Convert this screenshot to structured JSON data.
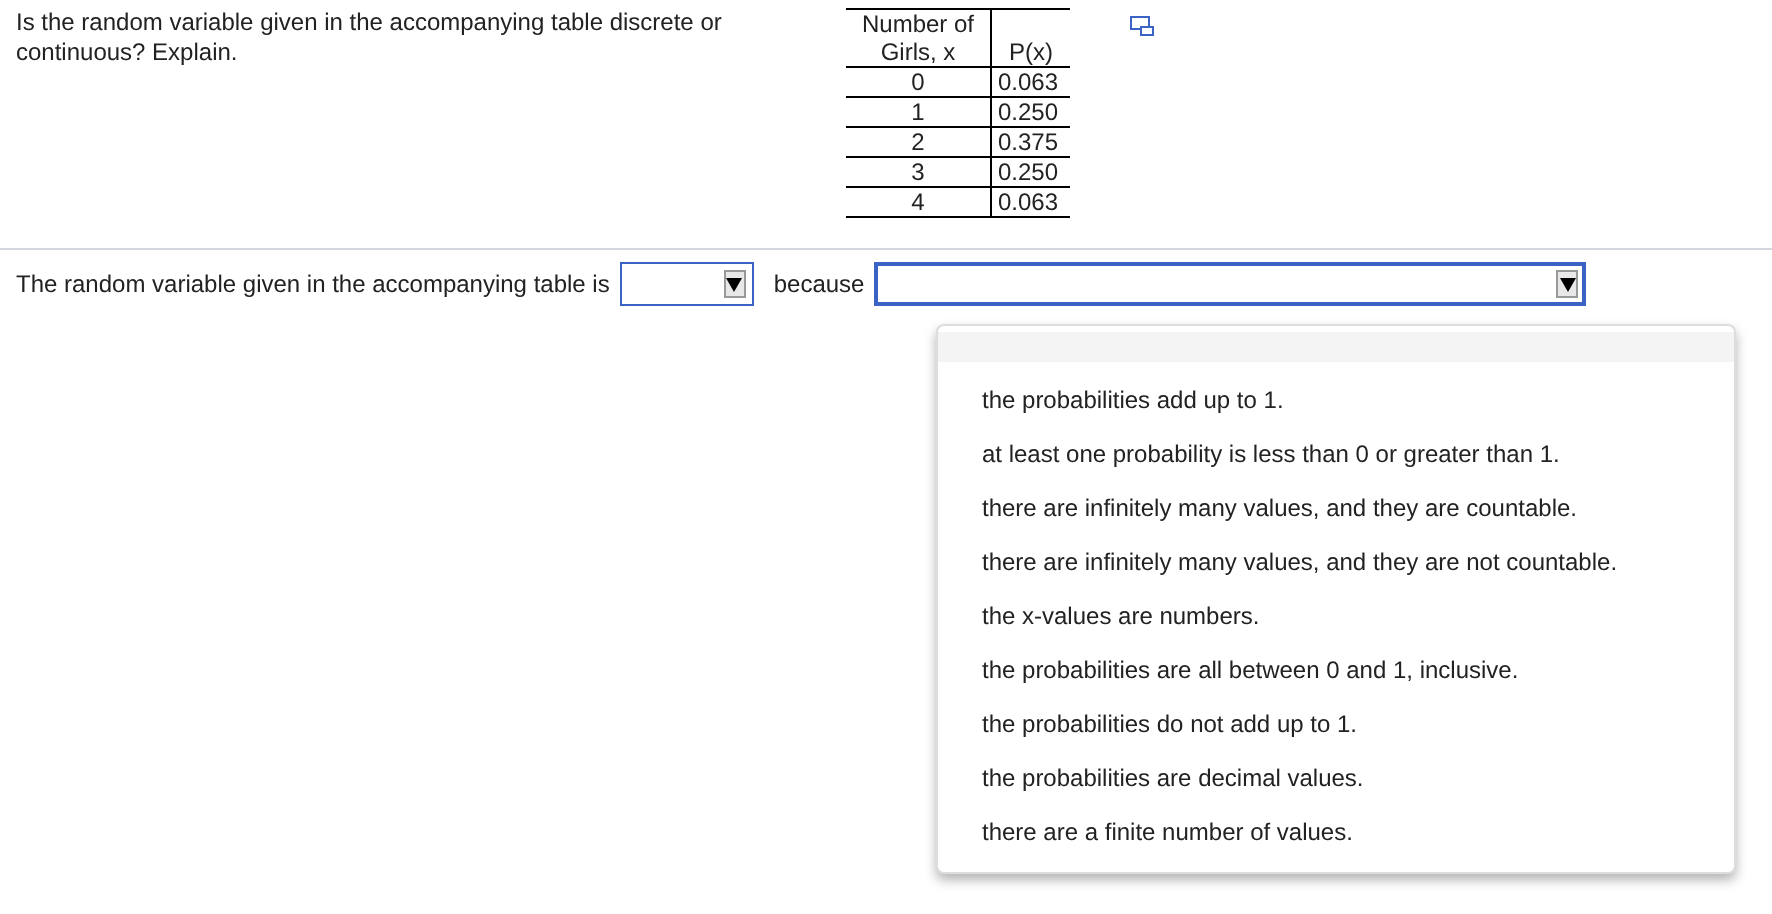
{
  "question": "Is the random variable given in the accompanying table discrete or continuous? Explain.",
  "table": {
    "columns": [
      "Number of Girls, x",
      "P(x)"
    ],
    "rows": [
      [
        "0",
        "0.063"
      ],
      [
        "1",
        "0.250"
      ],
      [
        "2",
        "0.375"
      ],
      [
        "3",
        "0.250"
      ],
      [
        "4",
        "0.063"
      ]
    ]
  },
  "answer": {
    "prefix": "The random variable given in the accompanying table is",
    "middle": "because",
    "dropdown_1": {
      "expanded": false
    },
    "dropdown_2": {
      "expanded": true,
      "options": [
        {
          "label": "the probabilities add up to 1."
        },
        {
          "label": "at least one probability is less than 0 or greater than 1."
        },
        {
          "label": "there are infinitely many values, and they are countable."
        },
        {
          "label": "there are infinitely many values, and they are not countable."
        },
        {
          "label": "the x-values are numbers."
        },
        {
          "label": "the probabilities are all between 0 and 1, inclusive."
        },
        {
          "label": "the probabilities do not add up to 1."
        },
        {
          "label": "the probabilities are decimal values."
        },
        {
          "label": "there are a finite number of values."
        }
      ]
    }
  }
}
